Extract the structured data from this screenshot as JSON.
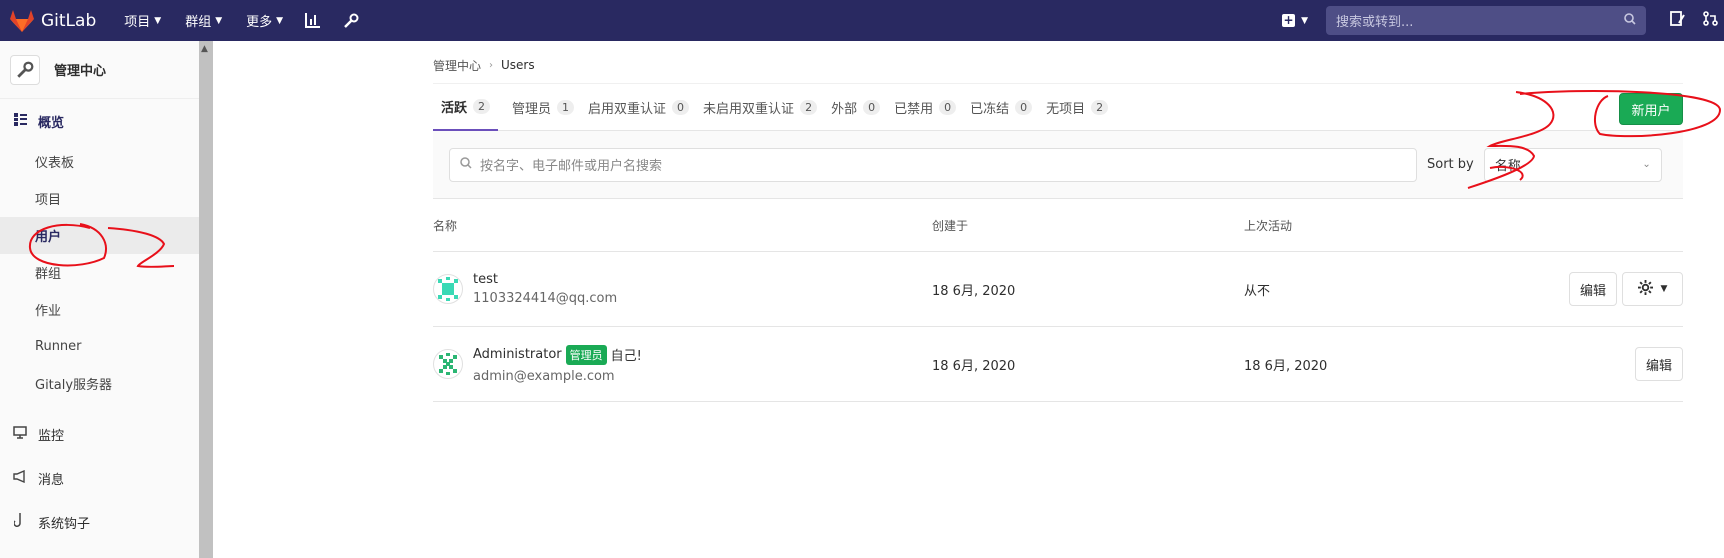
{
  "navbar": {
    "brand": "GitLab",
    "menu": [
      {
        "label": "项目"
      },
      {
        "label": "群组"
      },
      {
        "label": "更多"
      }
    ],
    "search_placeholder": "搜索或转到..."
  },
  "sidebar": {
    "title": "管理中心",
    "overview_label": "概览",
    "items": [
      {
        "label": "仪表板"
      },
      {
        "label": "项目"
      },
      {
        "label": "用户"
      },
      {
        "label": "群组"
      },
      {
        "label": "作业"
      },
      {
        "label": "Runner"
      },
      {
        "label": "Gitaly服务器"
      }
    ],
    "monitoring_label": "监控",
    "messages_label": "消息",
    "hooks_label": "系统钩子"
  },
  "breadcrumb": {
    "parent": "管理中心",
    "current": "Users"
  },
  "tabs": [
    {
      "label": "活跃",
      "count": "2"
    },
    {
      "label": "管理员",
      "count": "1"
    },
    {
      "label": "启用双重认证",
      "count": "0"
    },
    {
      "label": "未启用双重认证",
      "count": "2"
    },
    {
      "label": "外部",
      "count": "0"
    },
    {
      "label": "已禁用",
      "count": "0"
    },
    {
      "label": "已冻结",
      "count": "0"
    },
    {
      "label": "无项目",
      "count": "2"
    }
  ],
  "new_user_label": "新用户",
  "filter": {
    "search_placeholder": "按名字、电子邮件或用户名搜索",
    "sort_label": "Sort by",
    "sort_value": "名称"
  },
  "table": {
    "headers": {
      "name": "名称",
      "created": "创建于",
      "last_activity": "上次活动"
    },
    "rows": [
      {
        "name": "test",
        "email": "1103324414@qq.com",
        "created": "18 6月, 2020",
        "last_activity": "从不",
        "edit": "编辑"
      },
      {
        "name": "Administrator",
        "badge": "管理员",
        "self_label": "自己!",
        "email": "admin@example.com",
        "created": "18 6月, 2020",
        "last_activity": "18 6月, 2020",
        "edit": "编辑"
      }
    ]
  },
  "colors": {
    "navbar": "#292961",
    "accent_green": "#1aaa55",
    "annotation_red": "#e8101a"
  }
}
